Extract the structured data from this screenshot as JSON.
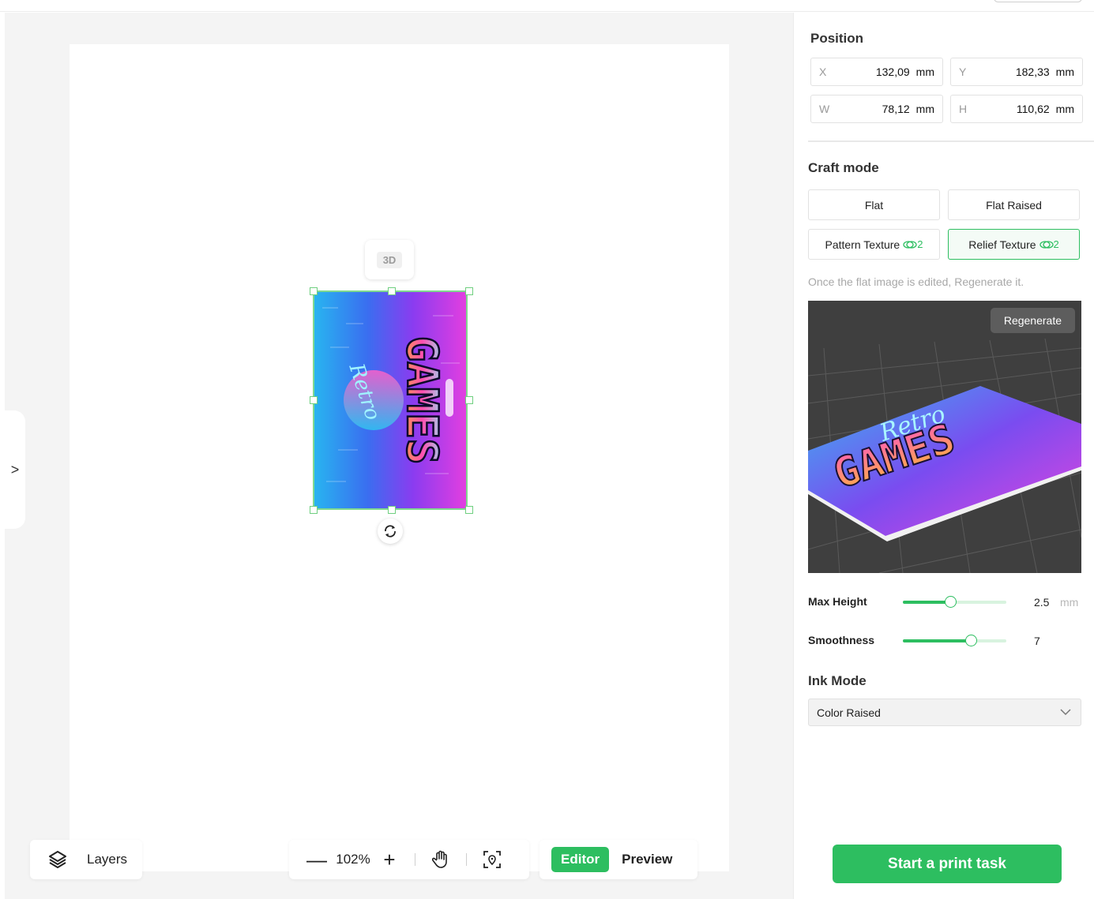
{
  "canvas": {
    "badge_3d": "3D",
    "artwork": {
      "title_top": "Retro",
      "title_main": "GAMES"
    }
  },
  "layers_button": {
    "label": "Layers",
    "icon": "layers-icon"
  },
  "zoom": {
    "value": "102%",
    "icons": [
      "zoom-out-icon",
      "zoom-in-icon",
      "hand-pan-icon",
      "locate-icon"
    ]
  },
  "view_mode": {
    "editor": "Editor",
    "preview": "Preview",
    "active": "Editor"
  },
  "panel": {
    "position": {
      "title": "Position",
      "x": {
        "key": "X",
        "value": "132,09",
        "unit": "mm"
      },
      "y": {
        "key": "Y",
        "value": "182,33",
        "unit": "mm"
      },
      "w": {
        "key": "W",
        "value": "78,12",
        "unit": "mm"
      },
      "h": {
        "key": "H",
        "value": "110,62",
        "unit": "mm"
      }
    },
    "craft_mode": {
      "title": "Craft mode",
      "options": [
        {
          "label": "Flat"
        },
        {
          "label": "Flat Raised"
        },
        {
          "label": "Pattern Texture",
          "cost": "2"
        },
        {
          "label": "Relief Texture",
          "cost": "2",
          "active": true
        }
      ],
      "hint": "Once the flat image is edited, Regenerate it.",
      "regenerate": "Regenerate"
    },
    "sliders": {
      "max_height": {
        "label": "Max Height",
        "value": "2.5",
        "unit": "mm",
        "fraction": 0.46
      },
      "smoothness": {
        "label": "Smoothness",
        "value": "7",
        "fraction": 0.66
      }
    },
    "ink_mode": {
      "title": "Ink Mode",
      "selected": "Color Raised"
    },
    "print_button": "Start a print task"
  },
  "colors": {
    "accent": "#2dbe60",
    "preview_bg": "#3f3f3f"
  }
}
